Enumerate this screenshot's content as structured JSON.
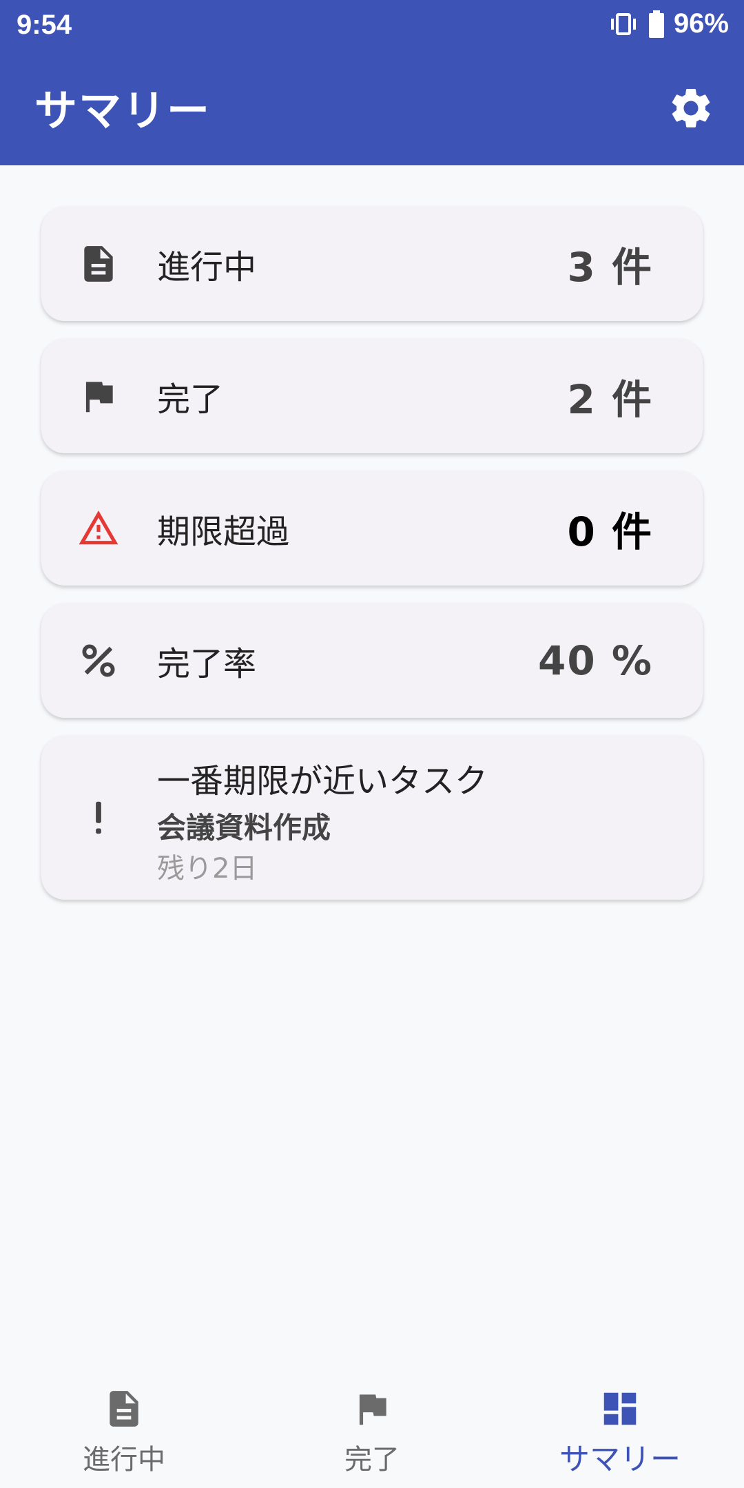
{
  "status": {
    "time": "9:54",
    "battery": "96%"
  },
  "header": {
    "title": "サマリー"
  },
  "cards": [
    {
      "label": "進行中",
      "value": "3 件",
      "icon": "document-icon"
    },
    {
      "label": "完了",
      "value": "2 件",
      "icon": "flag-icon"
    },
    {
      "label": "期限超過",
      "value": "0 件",
      "icon": "warning-icon"
    },
    {
      "label": "完了率",
      "value": "40 %",
      "icon": "percent-icon"
    }
  ],
  "deadline": {
    "title": "一番期限が近いタスク",
    "task": "会議資料作成",
    "remaining": "残り2日",
    "icon": "exclamation-icon"
  },
  "nav": [
    {
      "label": "進行中",
      "icon": "document-icon"
    },
    {
      "label": "完了",
      "icon": "flag-icon"
    },
    {
      "label": "サマリー",
      "icon": "dashboard-icon"
    }
  ],
  "colors": {
    "primary": "#3e53b6",
    "warning": "#e53935",
    "card": "#f4f2f7"
  }
}
